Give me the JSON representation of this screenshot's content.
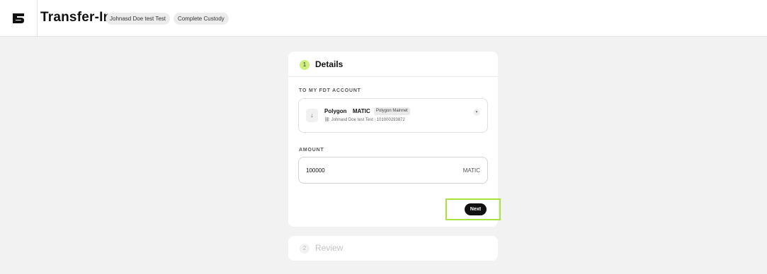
{
  "header": {
    "title": "Transfer-In",
    "account_name": "Johnasd Doe test Test",
    "account_type": "Complete Custody"
  },
  "steps": [
    {
      "number": "1",
      "title": "Details",
      "state": "active"
    },
    {
      "number": "2",
      "title": "Review",
      "state": "inactive"
    }
  ],
  "details": {
    "to_account_label": "TO MY FDT ACCOUNT",
    "account": {
      "network": "Polygon",
      "asset": "MATIC",
      "chain_badge": "Polygon Mainnet",
      "holder": "Johnasd Doe test Test",
      "account_number": "101000293872"
    },
    "amount_label": "AMOUNT",
    "amount_value": "100000",
    "amount_unit": "MATIC",
    "next_label": "Next"
  },
  "colors": {
    "accent": "#cdf07c",
    "highlight": "#a7e23e",
    "button": "#111111",
    "background": "#f2f2f2"
  },
  "icons": {
    "logo": "fdt-logo-icon",
    "arrow": "arrow-down-icon",
    "link": "link-icon",
    "dropdown": "chevron-down-icon"
  }
}
